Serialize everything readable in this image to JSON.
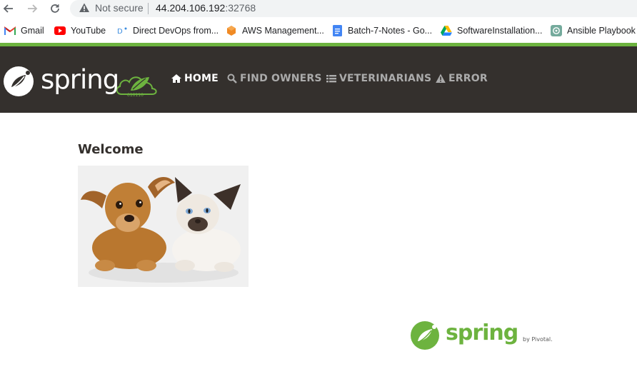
{
  "browser": {
    "url_warning": "Not secure",
    "url_host": "44.204.106.192",
    "url_port": ":32768",
    "bookmarks": [
      {
        "label": "Gmail",
        "icon": "gmail-icon"
      },
      {
        "label": "YouTube",
        "icon": "youtube-icon"
      },
      {
        "label": "Direct DevOps from...",
        "icon": "devops-icon"
      },
      {
        "label": "AWS Management...",
        "icon": "aws-icon"
      },
      {
        "label": "Batch-7-Notes - Go...",
        "icon": "google-docs-icon"
      },
      {
        "label": "SoftwareInstallation...",
        "icon": "google-drive-icon"
      },
      {
        "label": "Ansible Playbook F",
        "icon": "chatgpt-icon"
      }
    ]
  },
  "header": {
    "brand": "spring",
    "nav": [
      {
        "label": "HOME",
        "icon": "home-icon",
        "active": true
      },
      {
        "label": "FIND OWNERS",
        "icon": "search-icon",
        "active": false
      },
      {
        "label": "VETERINARIANS",
        "icon": "list-icon",
        "active": false
      },
      {
        "label": "ERROR",
        "icon": "warning-icon",
        "active": false
      }
    ]
  },
  "main": {
    "heading": "Welcome"
  },
  "footer": {
    "brand": "spring",
    "by": "by Pivotal."
  },
  "colors": {
    "spring_green": "#6db33f",
    "navbar_bg": "#34302d"
  }
}
